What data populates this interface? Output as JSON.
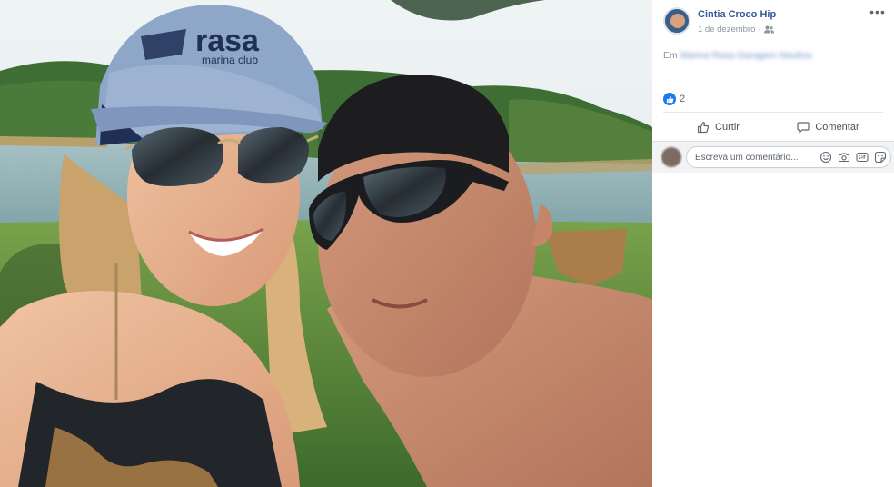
{
  "photo": {
    "alt_subject": "selfie-couple-lake"
  },
  "post": {
    "author": "Cintia Croco Hip",
    "date": "1 de dezembro",
    "date_separator": "·",
    "privacy_icon": "friends-icon",
    "more_label": "•••",
    "location_prefix": "Em",
    "location_name": "Marina Rasa Garagem Nautica",
    "reaction_count": "2",
    "like_label": "Curtir",
    "comment_label": "Comentar",
    "comment_placeholder": "Escreva um comentário..."
  },
  "colors": {
    "link_blue": "#385898",
    "facebook_blue": "#1877f2",
    "muted_text": "#90949c",
    "comment_bg": "#f2f3f5"
  },
  "icons": [
    "like-icon",
    "comment-icon",
    "emoji-icon",
    "camera-icon",
    "gif-icon",
    "sticker-icon",
    "more-icon"
  ]
}
